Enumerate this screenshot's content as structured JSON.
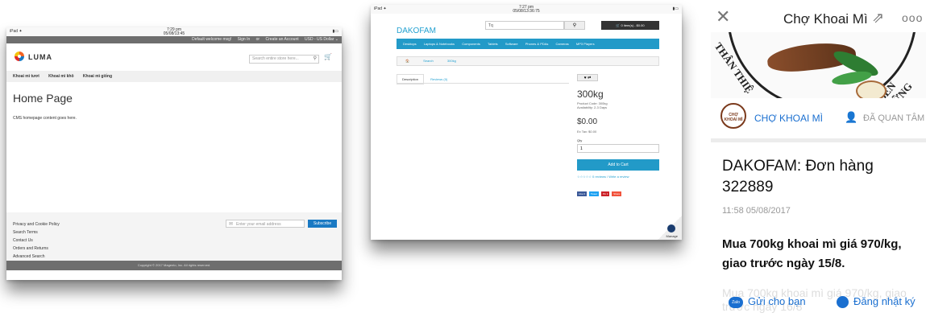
{
  "shot1": {
    "status": {
      "left": "iPad ✦",
      "time": "7:29 pm",
      "date": "05/08/13:45",
      "battery": "▮▭"
    },
    "topbar": {
      "welcome": "Default welcome msg!",
      "signin": "Sign In",
      "or": "or",
      "create": "Create an Account",
      "currency": "USD - US Dollar ⌄"
    },
    "logo_text": "LUMA",
    "search_placeholder": "Search entire store here...",
    "nav": [
      "Khoai mì tươi",
      "Khoai mì khô",
      "Khoai mì giống"
    ],
    "page_title": "Home Page",
    "cms_text": "CMS homepage content goes here.",
    "footer_links": [
      "Privacy and Cookie Policy",
      "Search Terms",
      "Contact Us",
      "Orders and Returns",
      "Advanced Search"
    ],
    "email_placeholder": "Enter your email address",
    "subscribe": "Subscribe",
    "copyright": "Copyright © 2017 Magento, Inc. All rights reserved."
  },
  "shot2": {
    "status": {
      "left": "iPad ✦",
      "time": "7:27 pm",
      "date": "05/08/13:36:75",
      "battery": "▮▭"
    },
    "brand": "DAKOFAM",
    "search_value": "Tq",
    "cart": "0 item(s) - $0.00",
    "nav": [
      "Desktops",
      "Laptops & Notebooks",
      "Components",
      "Tablets",
      "Software",
      "Phones & PDAs",
      "Cameras",
      "MP3 Players"
    ],
    "breadcrumb": [
      "🏠",
      "Search",
      "300kg"
    ],
    "tabs": [
      "Description",
      "Reviews (0)"
    ],
    "wish": "♥ ⇄",
    "product_name": "300kg",
    "product_code": "Product Code: 300kg",
    "availability": "Availability: 2-3 Days",
    "price": "$0.00",
    "ex_tax": "Ex Tax: $0.00",
    "qty_label": "Qty",
    "qty_value": "1",
    "add_to_cart": "Add to Cart",
    "reviews": "☆☆☆☆☆ 0 reviews / Write a review",
    "share": [
      "Like 0",
      "Tweet",
      "Pin it",
      "Share"
    ],
    "manage": "Manage"
  },
  "shot3": {
    "title": "Chợ Khoai Mì",
    "close": "✕",
    "share": "⇗",
    "more": "ooo",
    "banner_left": "THÂN THIỆ",
    "banner_right": "BỀN VỮNG",
    "avatar_text": "CHỢ KHOAI MÌ",
    "page_name": "CHỢ KHOAI MÌ",
    "follow": "ĐÃ QUAN TÂM",
    "headline": "DAKOFAM: Đơn hàng 322889",
    "time": "11:58 05/08/2017",
    "body": "Mua 700kg khoai mì giá 970/kg, giao trước ngày 15/8.",
    "ghost": "Mua 700kg khoai mì giá 970/kg, giao trước ngày 16/8",
    "send": "Gửi cho bạn",
    "zalo": "Zalo",
    "diary": "Đăng nhật ký"
  }
}
